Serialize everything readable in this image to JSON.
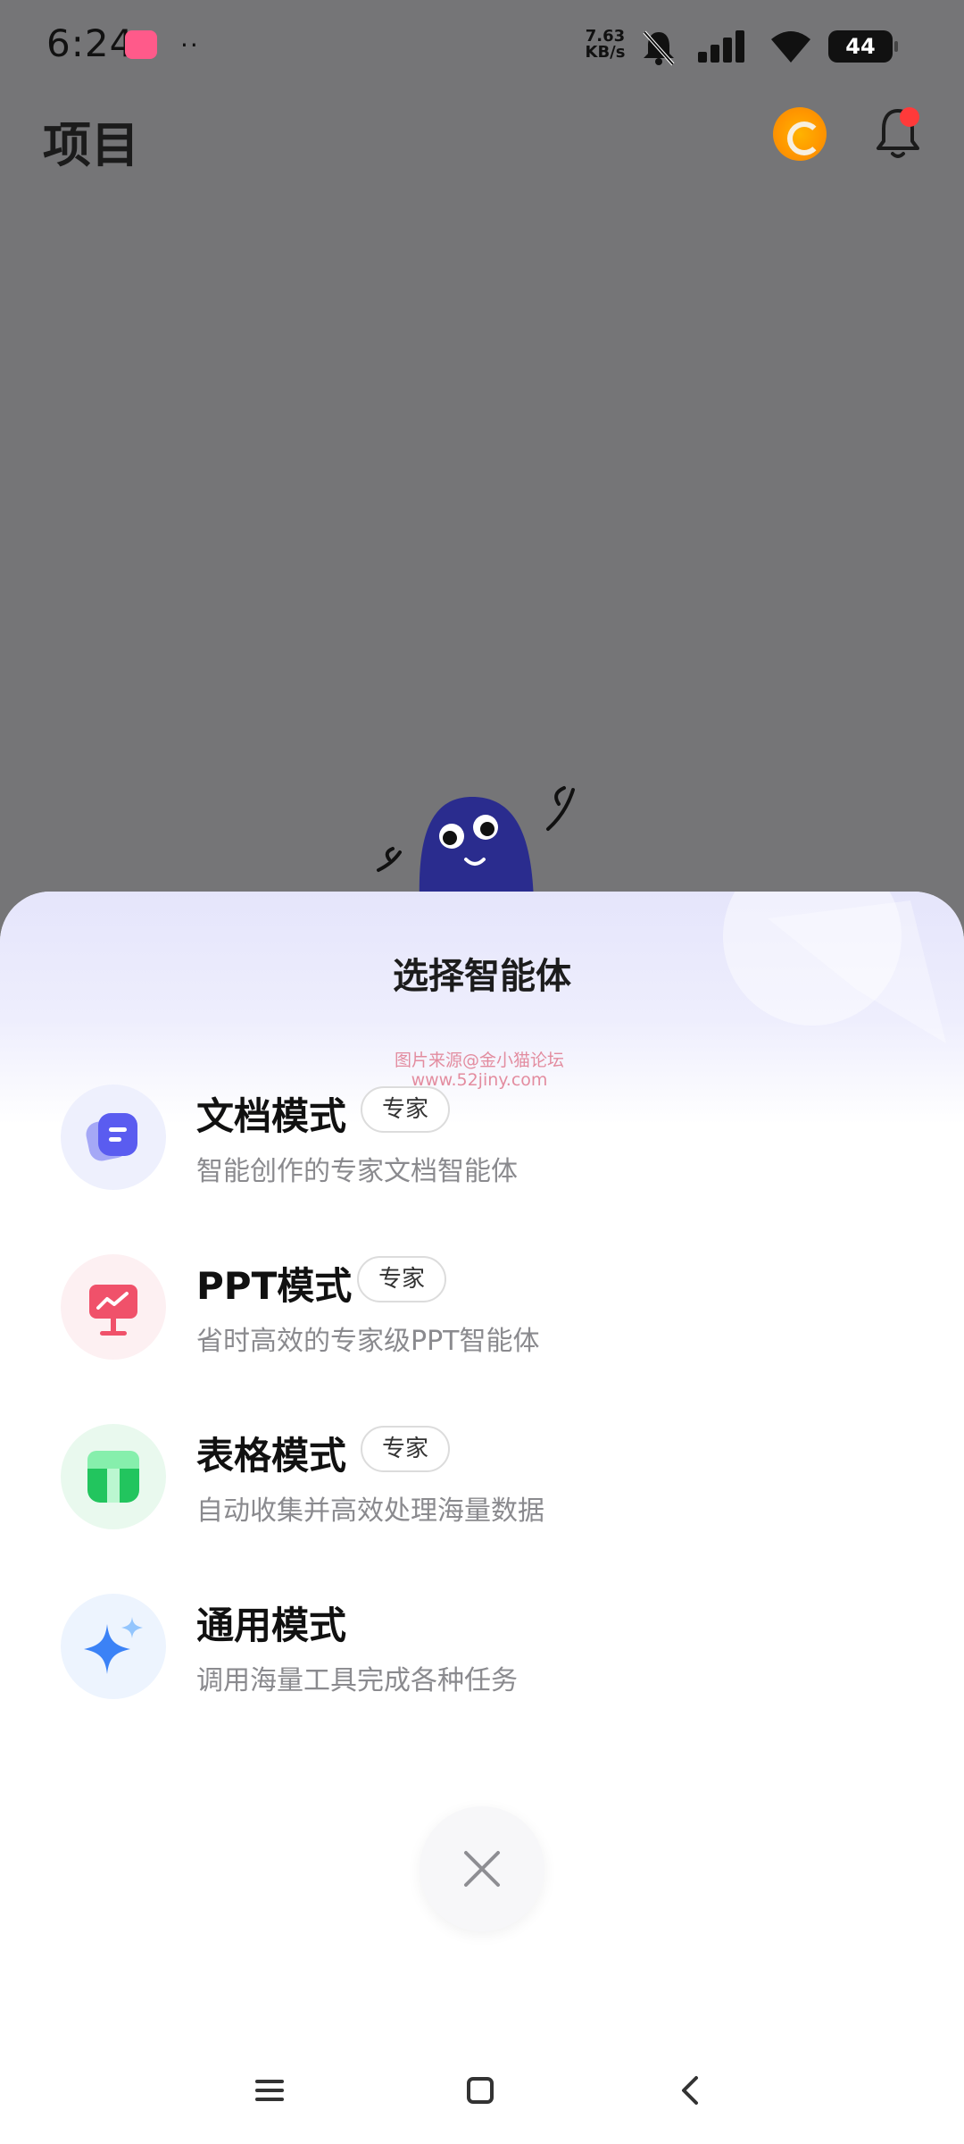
{
  "status_bar": {
    "time": "6:24",
    "dots": "··",
    "net_speed_value": "7.63",
    "net_speed_unit": "KB/s",
    "battery": "44",
    "icons": [
      "app-notification-icon",
      "bell-off-icon",
      "signal-icon",
      "wifi-icon",
      "battery-icon"
    ]
  },
  "header": {
    "title": "项目",
    "icons": [
      "coin-icon",
      "bell-icon"
    ],
    "notification_dot_color": "#ff3a3a"
  },
  "sheet": {
    "title": "选择智能体",
    "watermark_line1": "图片来源@金小猫论坛",
    "watermark_line2": "www.52jiny.com",
    "modes": [
      {
        "name": "文档模式",
        "tag": "专家",
        "desc": "智能创作的专家文档智能体",
        "icon": "document-icon",
        "icon_color": "#5a5cf0"
      },
      {
        "name": "PPT模式",
        "tag": "专家",
        "desc": "省时高效的专家级PPT智能体",
        "icon": "presentation-icon",
        "icon_color": "#f0516a"
      },
      {
        "name": "表格模式",
        "tag": "专家",
        "desc": "自动收集并高效处理海量数据",
        "icon": "table-icon",
        "icon_color": "#22c55e"
      },
      {
        "name": "通用模式",
        "desc": "调用海量工具完成各种任务",
        "icon": "sparkle-icon",
        "icon_color": "#3b82f6"
      }
    ],
    "close_icon": "close-icon"
  },
  "nav_bar": {
    "buttons": [
      "menu-icon",
      "home-icon",
      "back-icon"
    ]
  }
}
